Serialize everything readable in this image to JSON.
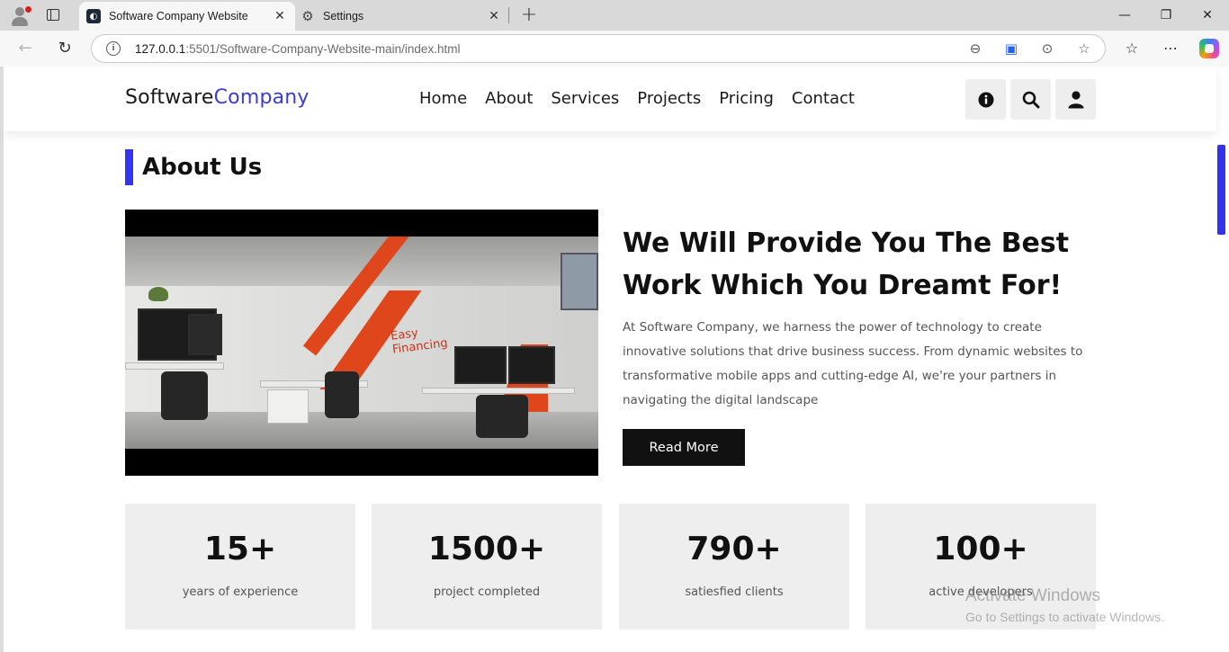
{
  "browser": {
    "tabs": [
      {
        "title": "Software Company Website",
        "active": true,
        "icon": "site-favicon"
      },
      {
        "title": "Settings",
        "active": false,
        "icon": "gear-icon"
      }
    ],
    "url_host": "127.0.0.1",
    "url_rest": ":5501/Software-Company-Website-main/index.html"
  },
  "site": {
    "logo_main": "Software",
    "logo_accent": "Company",
    "accent_color": "#3b3bd6",
    "nav": [
      "Home",
      "About",
      "Services",
      "Projects",
      "Pricing",
      "Contact"
    ],
    "header_buttons": [
      "info-icon",
      "search-icon",
      "user-icon"
    ]
  },
  "about": {
    "section_title": "About Us",
    "heading": "We Will Provide You The Best Work Which You Dreamt For!",
    "paragraph": "At Software Company, we harness the power of technology to create innovative solutions that drive business success. From dynamic websites to transformative mobile apps and cutting-edge AI, we're your partners in navigating the digital landscape",
    "button": "Read More",
    "video_wall_text": "Easy Financing"
  },
  "stats": [
    {
      "value": "15+",
      "label": "years of experience"
    },
    {
      "value": "1500+",
      "label": "project completed"
    },
    {
      "value": "790+",
      "label": "satiesfied clients"
    },
    {
      "value": "100+",
      "label": "active developers"
    }
  ],
  "watermark": {
    "line1": "Activate Windows",
    "line2": "Go to Settings to activate Windows."
  }
}
